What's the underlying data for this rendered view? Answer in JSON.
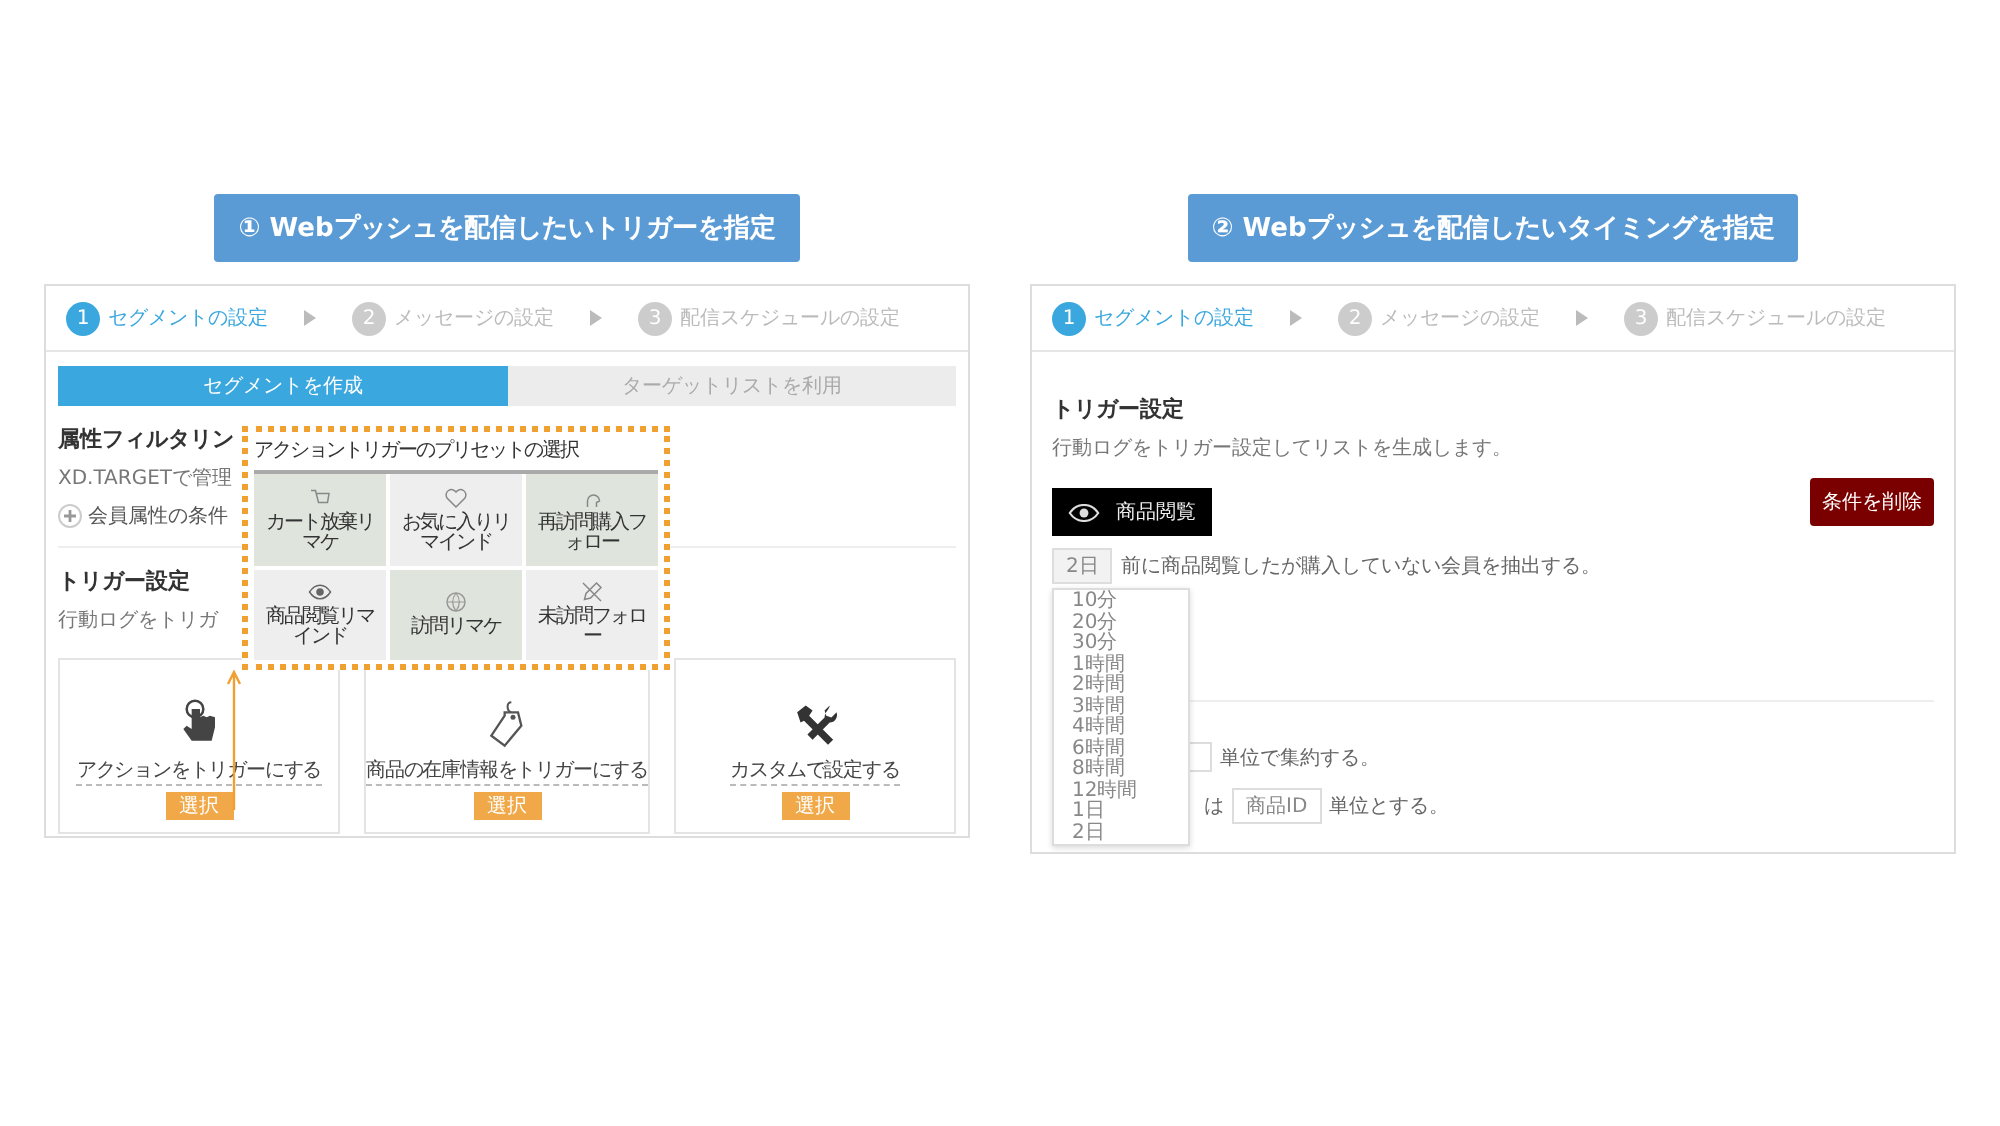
{
  "panels": [
    {
      "caption": "① Webプッシュを配信したいトリガーを指定",
      "screen": {
        "kind": "segment",
        "steps": [
          {
            "number": "1",
            "label": "セグメントの設定",
            "selected": true
          },
          {
            "number": "2",
            "label": "メッセージの設定",
            "selected": false
          },
          {
            "number": "3",
            "label": "配信スケジュールの設定",
            "selected": false
          }
        ],
        "tabs": [
          {
            "label": "セグメントを作成",
            "selected": true
          },
          {
            "label": "ターゲットリストを利用",
            "selected": false
          }
        ],
        "attribute_section": {
          "heading": "属性フィルタリン",
          "description": "XD.TARGETで管理",
          "add_link": "会員属性の条件"
        },
        "trigger_section": {
          "heading": "トリガー設定",
          "description": "行動ログをトリガ"
        },
        "options": [
          {
            "kind": "touch",
            "label": "アクションをトリガーにする",
            "button": "選択"
          },
          {
            "kind": "tag",
            "label": "商品の在庫情報をトリガーにする",
            "button": "選択"
          },
          {
            "kind": "tools",
            "label": "カスタムで設定する",
            "button": "選択"
          }
        ],
        "preset_popup": {
          "title": "アクショントリガーのプリセットの選択",
          "presets": [
            {
              "kind": "cart",
              "title": "カート放棄リマケ",
              "shaded": true
            },
            {
              "kind": "heart",
              "title": "お気に入りリマインド",
              "shaded": false
            },
            {
              "kind": "person",
              "title": "再訪問購入フォロー",
              "shaded": true
            },
            {
              "kind": "eye",
              "title": "商品閲覧リマインド",
              "shaded": false
            },
            {
              "kind": "globe",
              "title": "訪問リマケ",
              "shaded": true
            },
            {
              "kind": "pen",
              "title": "未訪問フォロー",
              "shaded": false
            }
          ]
        }
      }
    },
    {
      "caption": "② Webプッシュを配信したいタイミングを指定",
      "screen": {
        "kind": "trigger",
        "steps": [
          {
            "number": "1",
            "label": "セグメントの設定",
            "selected": true
          },
          {
            "number": "2",
            "label": "メッセージの設定",
            "selected": false
          },
          {
            "number": "3",
            "label": "配信スケジュールの設定",
            "selected": false
          }
        ],
        "trigger_section": {
          "heading": "トリガー設定",
          "description": "行動ログをトリガー設定してリストを生成します。"
        },
        "action_badge": "商品閲覧",
        "delete_button": "条件を削除",
        "condition": {
          "select": "2日",
          "text": "前に商品閲覧したが購入していない会員を抽出する。"
        },
        "dropdown_options": [
          "10分",
          "20分",
          "30分",
          "1時間",
          "2時間",
          "3時間",
          "4時間",
          "6時間",
          "8時間",
          "12時間",
          "1日",
          "2日"
        ],
        "aggregate_rows": [
          {
            "kind": "select-first",
            "text": "単位で集約する。"
          },
          {
            "kind": "prefix",
            "prefix": "は",
            "select": "商品ID",
            "text": "単位とする。"
          }
        ]
      }
    }
  ]
}
